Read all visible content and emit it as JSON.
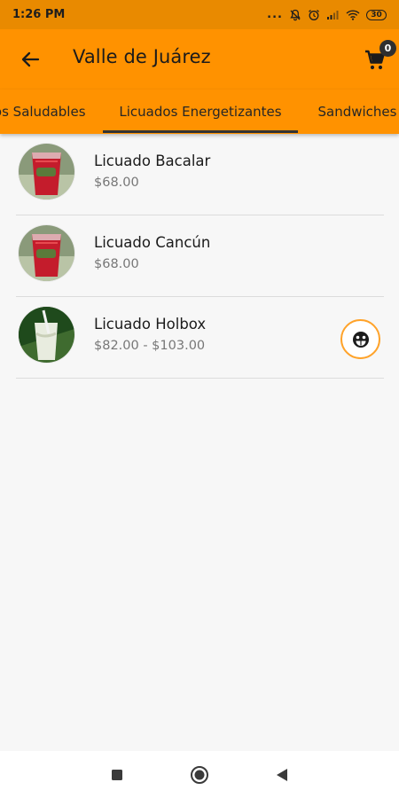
{
  "status_bar": {
    "time": "1:26 PM",
    "dots": "...",
    "battery": "30"
  },
  "appbar": {
    "title": "Valle de Juárez",
    "cart_count": "0"
  },
  "tabs": [
    {
      "label": "Jugos Saludables"
    },
    {
      "label": "Licuados Energetizantes",
      "active": true
    },
    {
      "label": "Sandwiches"
    }
  ],
  "products": [
    {
      "name": "Licuado Bacalar",
      "price": "$68.00",
      "image": "red-smoothie-cup"
    },
    {
      "name": "Licuado Cancún",
      "price": "$68.00",
      "image": "red-smoothie-cup"
    },
    {
      "name": "Licuado Holbox",
      "price": "$82.00 - $103.00",
      "image": "white-smoothie-cup",
      "action_icon": "smiley-face-icon"
    }
  ],
  "colors": {
    "status_bar": "#e98a00",
    "primary": "#ff9200",
    "accent_outline": "#ffa32a",
    "background": "#f7f7f7"
  }
}
